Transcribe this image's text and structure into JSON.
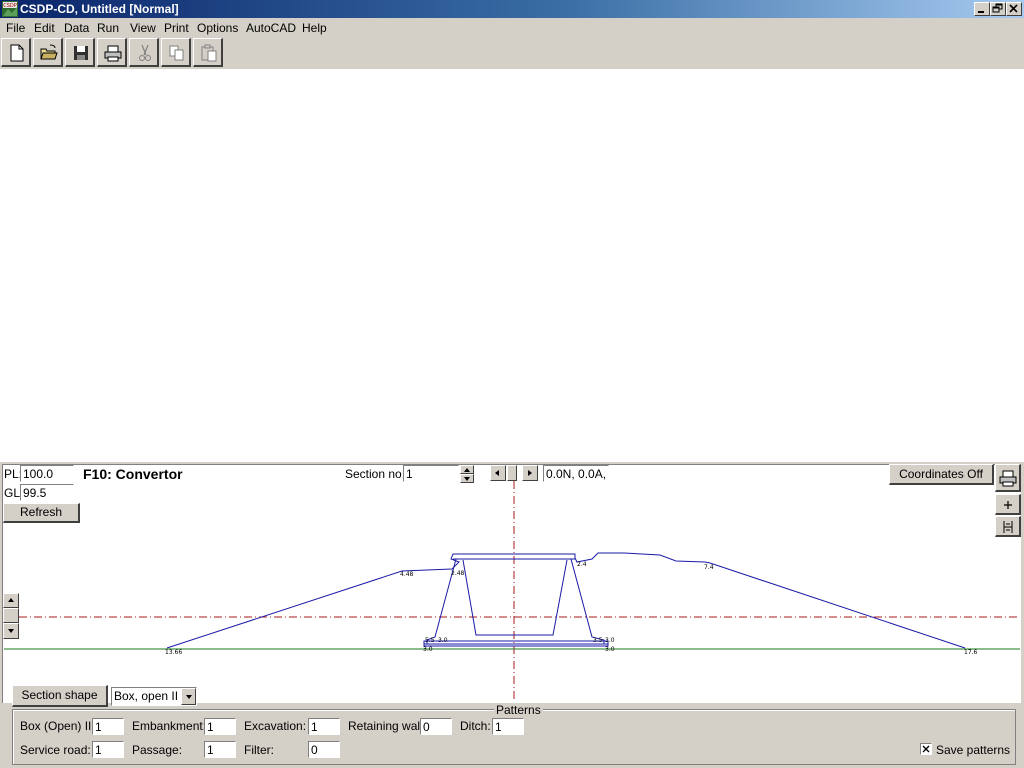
{
  "window": {
    "title": "CSDP-CD, Untitled [Normal]",
    "icon": "csdp-app-icon",
    "controls": [
      "minimize-icon",
      "restore-icon",
      "close-icon"
    ]
  },
  "menu": [
    "File",
    "Edit",
    "Data",
    "Run",
    "View",
    "Print",
    "Options",
    "AutoCAD",
    "Help"
  ],
  "toolbar": [
    {
      "name": "new-button",
      "icon": "new-document-icon",
      "enabled": true
    },
    {
      "name": "open-button",
      "icon": "open-folder-icon",
      "enabled": true
    },
    {
      "name": "save-button",
      "icon": "save-disk-icon",
      "enabled": true
    },
    {
      "name": "print-button",
      "icon": "printer-icon",
      "enabled": true
    },
    {
      "name": "cut-button",
      "icon": "scissors-icon",
      "enabled": false
    },
    {
      "name": "copy-button",
      "icon": "copy-icon",
      "enabled": false
    },
    {
      "name": "paste-button",
      "icon": "paste-icon",
      "enabled": false
    }
  ],
  "panel": {
    "pl_label": "PL:",
    "pl_value": "100.0",
    "gl_label": "GL:",
    "gl_value": "99.5",
    "refresh": "Refresh",
    "heading": "F10: Convertor",
    "section_label": "Section no.:",
    "section_value": "1",
    "coord_readout": "0.0N, 0.0A, []",
    "coordinates_button": "Coordinates Off",
    "side_buttons": [
      "printer-icon",
      "plus-icon",
      "ruler-icon"
    ]
  },
  "drawing": {
    "labels": [
      "13.66",
      "4.48",
      "2.48",
      "2.4",
      "7.4",
      "17.6",
      "5.5",
      "3.0",
      "3.0",
      "3.5",
      "3.0",
      "3.0"
    ],
    "colors": {
      "section_line": "#1a1aa8",
      "ground_line": "#1a7a1a",
      "axis_dashdot": "#aa1a1a"
    }
  },
  "bottom": {
    "section_shape_button": "Section shape",
    "shape_select": "Box, open II",
    "patterns_title": "Patterns",
    "fields": [
      {
        "label": "Box (Open) II:",
        "value": "1"
      },
      {
        "label": "Embankment:",
        "value": "1"
      },
      {
        "label": "Excavation:",
        "value": "1"
      },
      {
        "label": "Retaining wall:",
        "value": "0"
      },
      {
        "label": "Ditch:",
        "value": "1"
      },
      {
        "label": "Service road:",
        "value": "1"
      },
      {
        "label": "Passage:",
        "value": "1"
      },
      {
        "label": "Filter:",
        "value": "0"
      }
    ],
    "save_patterns_label": "Save patterns",
    "save_patterns_checked": true
  }
}
